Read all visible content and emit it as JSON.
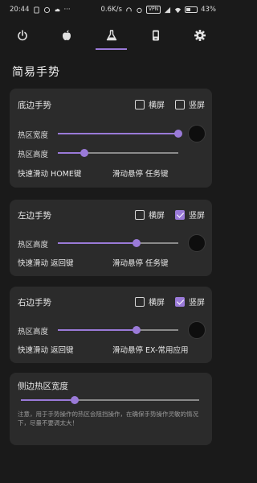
{
  "status_bar": {
    "time": "20:44",
    "speed": "0.6K/s",
    "vpn": "VPN",
    "battery": "43%",
    "battery_level": 0.43
  },
  "tabs": [
    {
      "icon": "power-icon",
      "active": false
    },
    {
      "icon": "apple-icon",
      "active": false
    },
    {
      "icon": "flask-icon",
      "active": true
    },
    {
      "icon": "phone-icon",
      "active": false
    },
    {
      "icon": "gear-icon",
      "active": false
    }
  ],
  "page_title": "简易手势",
  "bottom_gesture": {
    "title": "底边手势",
    "landscape_label": "横屏",
    "landscape_checked": false,
    "portrait_label": "竖屏",
    "portrait_checked": false,
    "width_label": "热区宽度",
    "width_value": 1.0,
    "height_label": "热区高度",
    "height_value": 0.22,
    "swipe_label": "快速滑动",
    "swipe_action": "HOME键",
    "hold_label": "滑动悬停",
    "hold_action": "任务键"
  },
  "left_gesture": {
    "title": "左边手势",
    "landscape_label": "横屏",
    "landscape_checked": false,
    "portrait_label": "竖屏",
    "portrait_checked": true,
    "height_label": "热区高度",
    "height_value": 0.65,
    "swipe_label": "快速滑动",
    "swipe_action": "返回键",
    "hold_label": "滑动悬停",
    "hold_action": "任务键"
  },
  "right_gesture": {
    "title": "右边手势",
    "landscape_label": "横屏",
    "landscape_checked": false,
    "portrait_label": "竖屏",
    "portrait_checked": true,
    "height_label": "热区高度",
    "height_value": 0.65,
    "swipe_label": "快速滑动",
    "swipe_action": "返回键",
    "hold_label": "滑动悬停",
    "hold_action": "EX-常用应用"
  },
  "side_width": {
    "title": "侧边热区宽度",
    "value": 0.3,
    "note": "注意，用于手势操作的热区会阻挡操作，在确保手势操作灵敏的情况下，尽量不要调太大！"
  }
}
